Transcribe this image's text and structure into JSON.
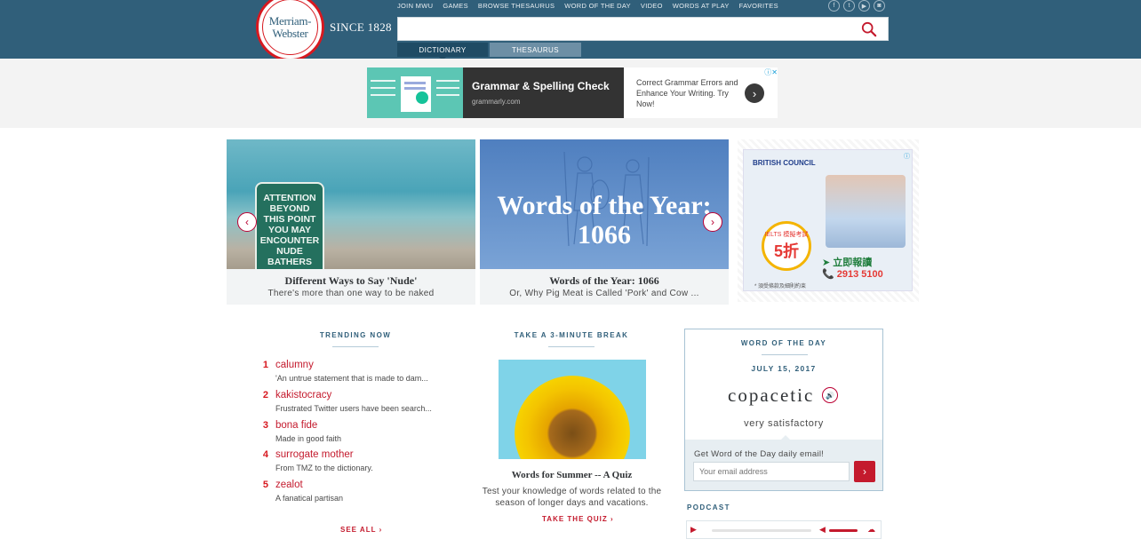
{
  "logo": {
    "line1": "Merriam-",
    "line2": "Webster",
    "since": "SINCE 1828"
  },
  "topnav": [
    "JOIN MWU",
    "GAMES",
    "BROWSE THESAURUS",
    "WORD OF THE DAY",
    "VIDEO",
    "WORDS AT PLAY",
    "FAVORITES"
  ],
  "social": [
    "f",
    "t",
    "▶",
    "◙"
  ],
  "search": {
    "value": "",
    "placeholder": ""
  },
  "tabs": {
    "dictionary": "DICTIONARY",
    "thesaurus": "THESAURUS"
  },
  "top_ad": {
    "title": "Grammar & Spelling Check",
    "domain": "grammarly.com",
    "copy": "Correct Grammar Errors and Enhance Your Writing. Try Now!",
    "arrow": "›",
    "close": "ⓘ✕"
  },
  "carousel": {
    "prev": "‹",
    "next": "›",
    "slides": [
      {
        "sign": "ATTENTION\nBEYOND\nTHIS POINT\nYOU MAY\nENCOUNTER\nNUDE\nBATHERS",
        "title": "Different Ways to Say 'Nude'",
        "subtitle": "There's more than one way to be naked"
      },
      {
        "overlay": "Words of the Year: 1066",
        "title": "Words of the Year: 1066",
        "subtitle": "Or, Why Pig Meat is Called 'Pork' and Cow ..."
      }
    ]
  },
  "side_ad": {
    "brand": "BRITISH COUNCIL",
    "badge_small": "IELTS 模擬考試",
    "badge_big": "5折",
    "cta": "➤ 立即報讀",
    "phone": "📞 2913 5100",
    "note": "* 須受條款及細則約束",
    "info": "ⓘ"
  },
  "trending": {
    "heading": "TRENDING NOW",
    "items": [
      {
        "num": "1",
        "word": "calumny",
        "desc": "'An untrue statement that is made to dam..."
      },
      {
        "num": "2",
        "word": "kakistocracy",
        "desc": "Frustrated Twitter users have been search..."
      },
      {
        "num": "3",
        "word": "bona fide",
        "desc": "Made in good faith"
      },
      {
        "num": "4",
        "word": "surrogate mother",
        "desc": "From TMZ to the dictionary."
      },
      {
        "num": "5",
        "word": "zealot",
        "desc": "A fanatical partisan"
      }
    ],
    "see_all": "SEE ALL ›"
  },
  "quiz": {
    "heading": "TAKE A 3-MINUTE BREAK",
    "title": "Words for Summer -- A Quiz",
    "desc": "Test your knowledge of words related to the season of longer days and vacations.",
    "cta": "TAKE THE QUIZ ›"
  },
  "wotd": {
    "heading": "WORD OF THE DAY",
    "date": "JULY 15, 2017",
    "word": "copacetic",
    "speaker": "🔊",
    "definition": "very satisfactory",
    "email_label": "Get Word of the Day daily email!",
    "email_placeholder": "Your email address",
    "go": "›"
  },
  "podcast": {
    "heading": "PODCAST",
    "play": "▶",
    "volume": "◀",
    "download": "☁",
    "progress": 0,
    "volume_level": 1
  }
}
